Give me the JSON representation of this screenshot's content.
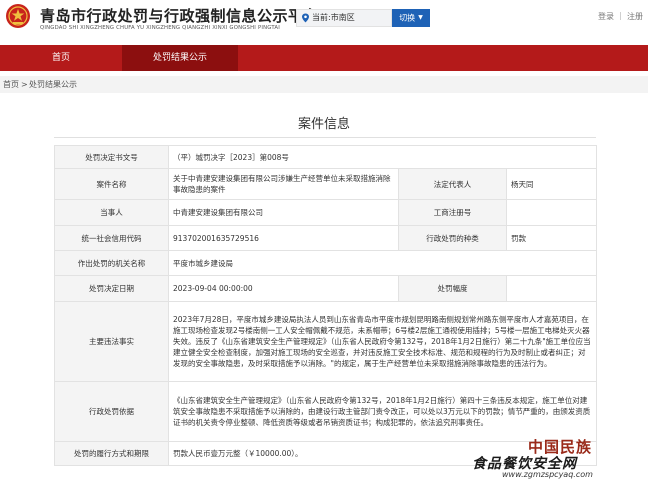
{
  "header": {
    "title": "青岛市行政处罚与行政强制信息公示平台",
    "subtitle": "QINGDAO SHI XINGZHENG CHUFA YU XINGZHENG QIANGZHI XINXI GONGSHI PINGTAI",
    "location": "当前:市南区",
    "switch_label": "切换",
    "login": "登录",
    "separator": "|",
    "register": "注册"
  },
  "nav": {
    "home": "首页",
    "penalty_results": "处罚结果公示"
  },
  "breadcrumb": {
    "home": "首页",
    "sep": ">",
    "current": "处罚结果公示"
  },
  "case": {
    "title": "案件信息",
    "rows": [
      {
        "label": "处罚决定书文号",
        "value": "（平）城罚决字［2023］第008号"
      },
      {
        "label": "案件名称",
        "value": "关于中青建安建设集团有限公司涉嫌生产经营单位未采取措施消除事故隐患的案件",
        "label2": "法定代表人",
        "value2": "杨天同"
      },
      {
        "label": "当事人",
        "value": "中青建安建设集团有限公司",
        "label2": "工商注册号",
        "value2": ""
      },
      {
        "label": "统一社会信用代码",
        "value": "913702001635729516",
        "label2": "行政处罚的种类",
        "value2": "罚款"
      },
      {
        "label": "作出处罚的机关名称",
        "value": "平度市城乡建设局"
      },
      {
        "label": "处罚决定日期",
        "value": "2023-09-04 00:00:00",
        "label2": "处罚幅度",
        "value2": ""
      },
      {
        "label": "主要违法事实",
        "value": "2023年7月28日，平度市城乡建设局执法人员到山东省青岛市平度市规划昆明路南侧规划常州路东侧平度市人才嘉苑项目，在施工现场检查发现2号楼南侧一工人安全帽佩戴不规范，未系帽带；6号楼2层施工通视使用插排；5号楼一层施工电梯处灭火器失效。违反了《山东省建筑安全生产管理规定》（山东省人民政府令第132号，2018年1月2日施行）第二十九条\"施工单位应当建立健全安全检查制度，加强对施工现场的安全巡查，并对违反施工安全技术标准、规范和规程的行为及时制止或者纠正；对发现的安全事故隐患，及时采取措施予以消除。\"的规定，属于生产经营单位未采取措施消除事故隐患的违法行为。"
      },
      {
        "label": "行政处罚依据",
        "value": "《山东省建筑安全生产管理规定》（山东省人民政府令第132号，2018年1月2日施行）第四十三条违反本规定，施工单位对建筑安全事故隐患不采取措施予以消除的，由建设行政主管部门责令改正，可以处以3万元以下的罚款；情节严重的，由颁发资质证书的机关责令停业整顿、降低资质等级或者吊销资质证书；构成犯罪的，依法追究刑事责任。"
      },
      {
        "label": "处罚的履行方式和期限",
        "value": "罚款人民币壹万元整（￥10000.00）。"
      }
    ]
  },
  "watermark": {
    "line1": "中国民族",
    "line2": "食品餐饮安全网",
    "line3": "www.zgmzspcyaq.com"
  },
  "colors": {
    "nav_red": "#b41a1a",
    "nav_active": "#8c0f0f",
    "switch_blue": "#1e62b6"
  }
}
